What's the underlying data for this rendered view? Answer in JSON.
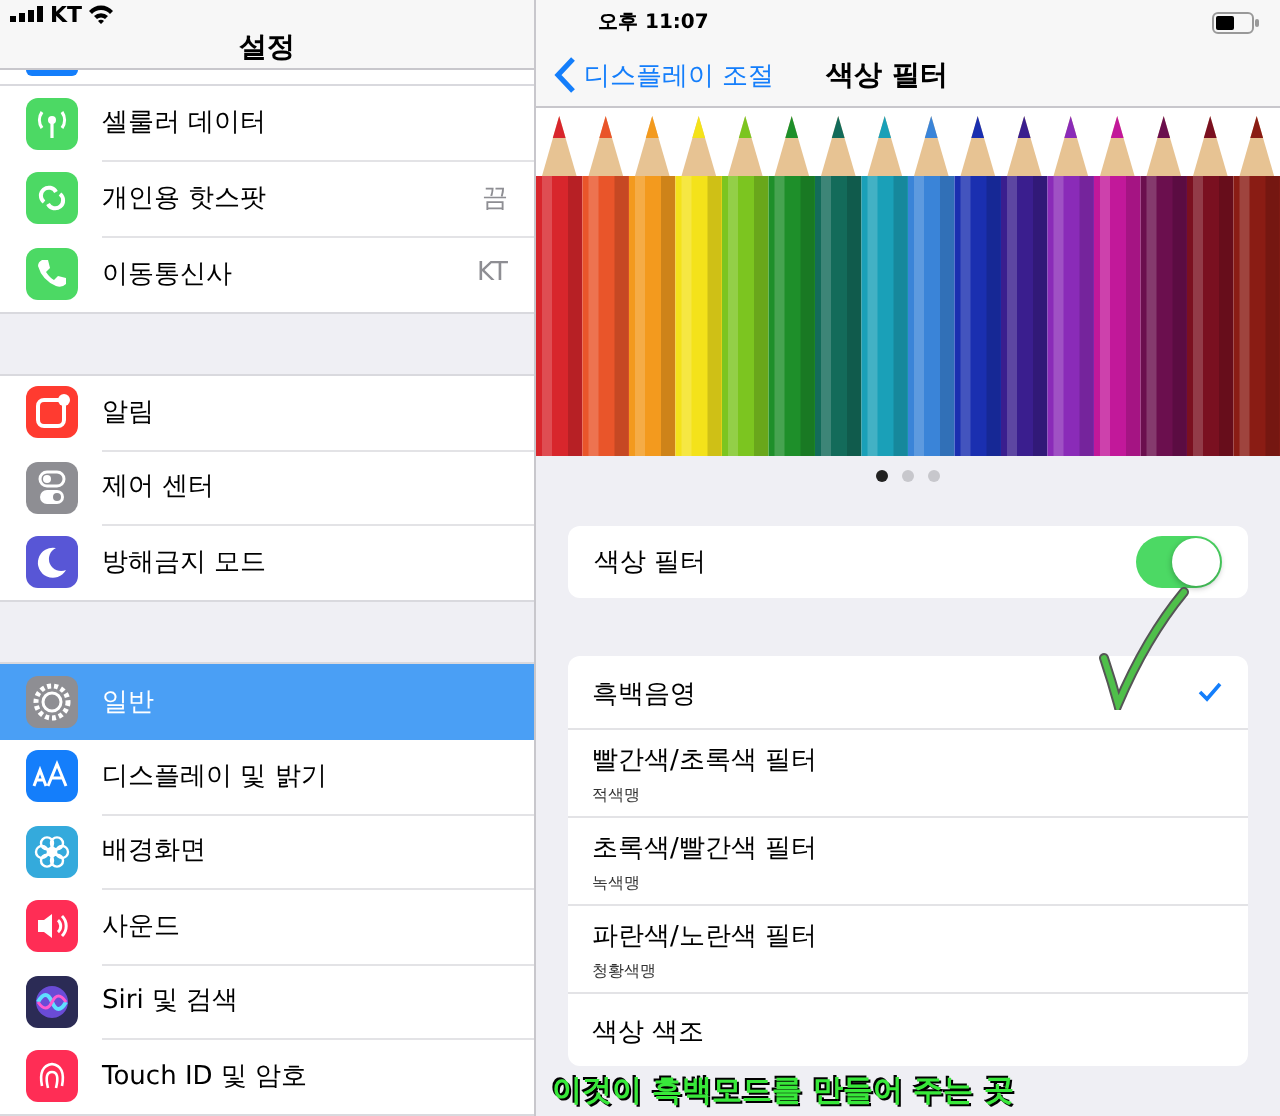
{
  "status_bar": {
    "carrier": "KT",
    "time": "오후 11:07"
  },
  "sidebar": {
    "title": "설정",
    "groups": [
      [
        {
          "label": "셀룰러 데이터",
          "selected": false
        },
        {
          "label": "개인용 핫스팟",
          "value": "끔",
          "selected": false
        },
        {
          "label": "이동통신사",
          "value": "KT",
          "selected": false
        }
      ],
      [
        {
          "label": "알림",
          "selected": false
        },
        {
          "label": "제어 센터",
          "selected": false
        },
        {
          "label": "방해금지 모드",
          "selected": false
        }
      ],
      [
        {
          "label": "일반",
          "selected": true
        },
        {
          "label": "디스플레이 및 밝기",
          "selected": false
        },
        {
          "label": "배경화면",
          "selected": false
        },
        {
          "label": "사운드",
          "selected": false
        },
        {
          "label": "Siri 및 검색",
          "selected": false
        },
        {
          "label": "Touch ID 및 암호",
          "selected": false
        }
      ]
    ]
  },
  "detail": {
    "back": "디스플레이 조절",
    "title": "색상 필터",
    "page_dots": [
      {
        "selected": true
      },
      {
        "selected": false
      },
      {
        "selected": false
      }
    ],
    "toggle": {
      "label": "색상 필터",
      "on": true
    },
    "filters": [
      {
        "label": "흑백음영",
        "checked": true
      },
      {
        "label": "빨간색/초록색 필터",
        "subtitle": "적색맹",
        "checked": false
      },
      {
        "label": "초록색/빨간색 필터",
        "subtitle": "녹색맹",
        "checked": false
      },
      {
        "label": "파란색/노란색 필터",
        "subtitle": "청황색맹",
        "checked": false
      },
      {
        "label": "색상 색조",
        "checked": false
      }
    ]
  },
  "annotation": {
    "text": "이것이 흑백모드를 만들어 주는 곳"
  }
}
